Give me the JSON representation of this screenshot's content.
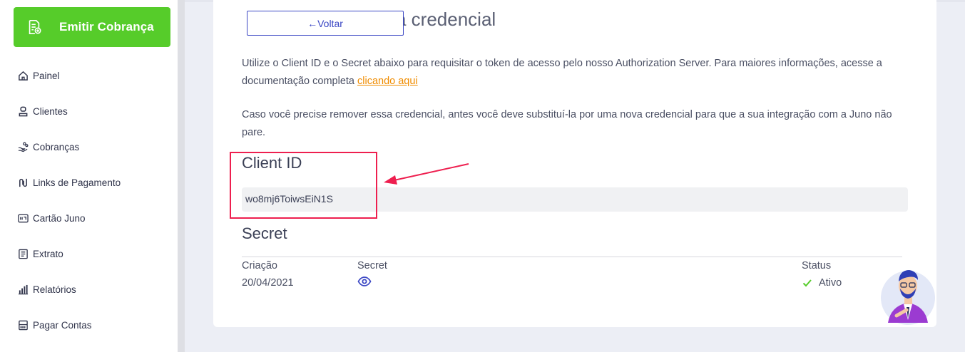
{
  "sidebar": {
    "emit_button": "Emitir Cobrança",
    "items": [
      {
        "label": "Painel",
        "icon": "home-icon"
      },
      {
        "label": "Clientes",
        "icon": "user-icon"
      },
      {
        "label": "Cobranças",
        "icon": "hand-coins-icon"
      },
      {
        "label": "Links de Pagamento",
        "icon": "link-icon"
      },
      {
        "label": "Cartão Juno",
        "icon": "card-icon"
      },
      {
        "label": "Extrato",
        "icon": "statement-icon"
      },
      {
        "label": "Relatórios",
        "icon": "bar-chart-icon"
      },
      {
        "label": "Pagar Contas",
        "icon": "barcode-icon"
      }
    ]
  },
  "header": {
    "back_label": "←Voltar",
    "title": "a credencial"
  },
  "content": {
    "para1_text": "Utilize o Client ID e o Secret abaixo para requisitar o token de acesso pelo nosso Authorization Server. Para maiores informações, acesse a documentação completa ",
    "para1_link": "clicando aqui",
    "para2_text": "Caso você precise remover essa credencial, antes você deve substituí-la por uma nova credencial para que a sua integração com a Juno não pare.",
    "client_id_heading": "Client ID",
    "client_id_value": "wo8mj6ToiwsEiN1S",
    "secret_heading": "Secret",
    "table": {
      "col_created": "Criação",
      "col_secret": "Secret",
      "col_status": "Status",
      "created_value": "20/04/2021",
      "status_value": "Ativo"
    }
  },
  "colors": {
    "accent_green": "#56cc2a",
    "primary_blue": "#3b47c4",
    "link_orange": "#f08c00",
    "annotation_red": "#ee1f4f"
  }
}
